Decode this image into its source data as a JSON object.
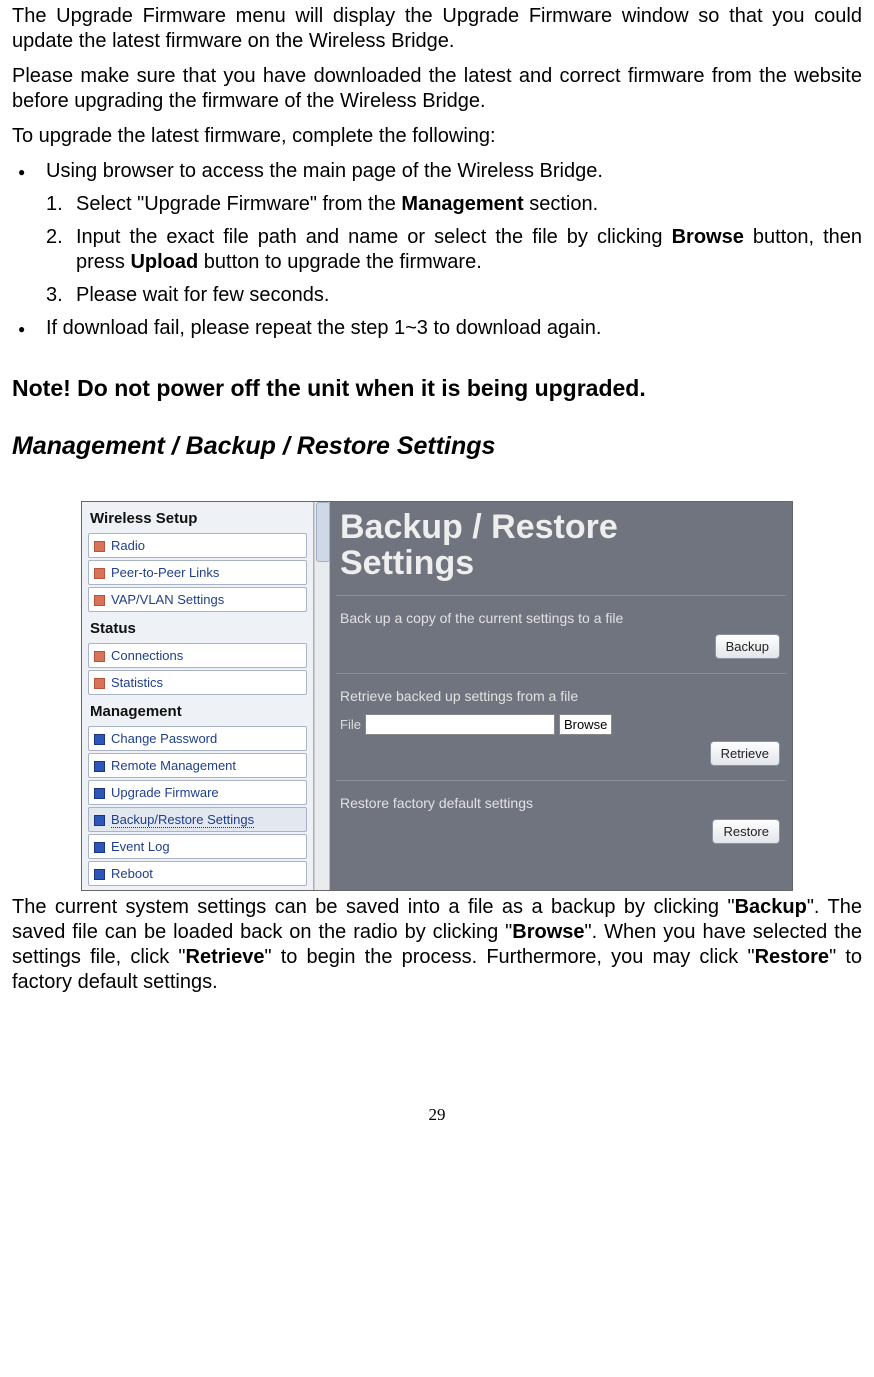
{
  "body": {
    "p1": "The Upgrade Firmware menu will display the Upgrade Firmware window so that you could update the latest firmware on the Wireless Bridge.",
    "p2": "Please make sure that you have downloaded the latest and correct firmware from the website before upgrading the firmware of the Wireless Bridge.",
    "p3": "To upgrade the latest firmware, complete the following:",
    "bullet1": "Using browser to access the main page of the Wireless Bridge.",
    "step1_pre": "Select \"Upgrade Firmware\" from the ",
    "step1_bold": "Management",
    "step1_post": " section.",
    "step2_pre": "Input the exact file path and name or select the file by clicking ",
    "step2_bold1": "Browse",
    "step2_mid": " button, then press ",
    "step2_bold2": "Upload",
    "step2_post": " button to upgrade the firmware.",
    "step3": "Please wait for few seconds.",
    "bullet2": "If download fail, please repeat the step 1~3 to download again.",
    "note": "Note! Do not power off the unit when it is being upgraded.",
    "heading": "Management / Backup / Restore Settings",
    "closing_pre": "The current system settings can be saved into a file as a backup by clicking \"",
    "closing_b1": "Backup",
    "closing_mid1": "\". The saved file can be loaded back on the radio by clicking \"",
    "closing_b2": "Browse",
    "closing_mid2": "\".   When you have selected the settings file, click \"",
    "closing_b3": "Retrieve",
    "closing_mid3": "\" to begin the process.   Furthermore, you may click \"",
    "closing_b4": "Restore",
    "closing_post": "\" to factory default settings.",
    "page_number": "29"
  },
  "nums": {
    "n1": "1.",
    "n2": "2.",
    "n3": "3."
  },
  "shot": {
    "nav": {
      "cat1": "Wireless Setup",
      "i1": "Radio",
      "i2": "Peer-to-Peer Links",
      "i3": "VAP/VLAN Settings",
      "cat2": "Status",
      "i4": "Connections",
      "i5": "Statistics",
      "cat3": "Management",
      "i6": "Change Password",
      "i7": "Remote Management",
      "i8": "Upgrade Firmware",
      "i9": "Backup/Restore Settings",
      "i10": "Event Log",
      "i11": "Reboot"
    },
    "pane": {
      "title_l1": "Backup / Restore",
      "title_l2": "Settings",
      "sub1": "Back up a copy of the current settings to a file",
      "btn1": "Backup",
      "sub2": "Retrieve backed up settings from a file",
      "file_label": "File",
      "browse": "Browse",
      "btn2": "Retrieve",
      "sub3": "Restore factory default settings",
      "btn3": "Restore"
    }
  }
}
